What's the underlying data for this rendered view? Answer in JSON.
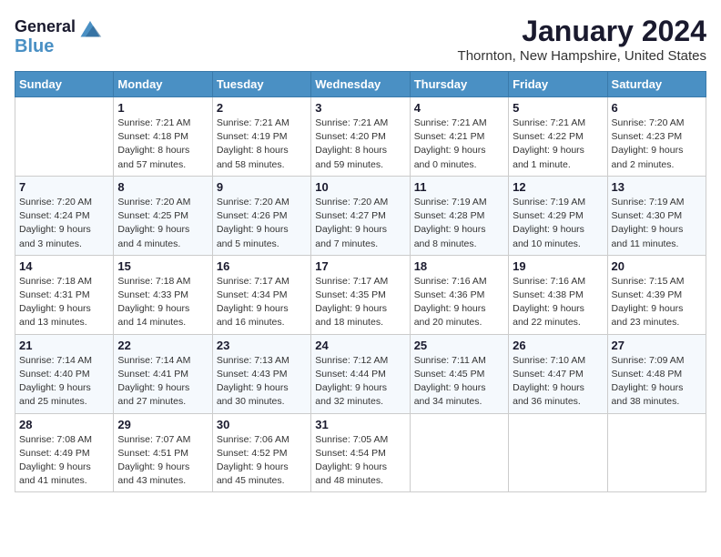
{
  "header": {
    "logo_line1": "General",
    "logo_line2": "Blue",
    "month": "January 2024",
    "location": "Thornton, New Hampshire, United States"
  },
  "weekdays": [
    "Sunday",
    "Monday",
    "Tuesday",
    "Wednesday",
    "Thursday",
    "Friday",
    "Saturday"
  ],
  "weeks": [
    [
      {
        "day": "",
        "info": ""
      },
      {
        "day": "1",
        "info": "Sunrise: 7:21 AM\nSunset: 4:18 PM\nDaylight: 8 hours\nand 57 minutes."
      },
      {
        "day": "2",
        "info": "Sunrise: 7:21 AM\nSunset: 4:19 PM\nDaylight: 8 hours\nand 58 minutes."
      },
      {
        "day": "3",
        "info": "Sunrise: 7:21 AM\nSunset: 4:20 PM\nDaylight: 8 hours\nand 59 minutes."
      },
      {
        "day": "4",
        "info": "Sunrise: 7:21 AM\nSunset: 4:21 PM\nDaylight: 9 hours\nand 0 minutes."
      },
      {
        "day": "5",
        "info": "Sunrise: 7:21 AM\nSunset: 4:22 PM\nDaylight: 9 hours\nand 1 minute."
      },
      {
        "day": "6",
        "info": "Sunrise: 7:20 AM\nSunset: 4:23 PM\nDaylight: 9 hours\nand 2 minutes."
      }
    ],
    [
      {
        "day": "7",
        "info": "Sunrise: 7:20 AM\nSunset: 4:24 PM\nDaylight: 9 hours\nand 3 minutes."
      },
      {
        "day": "8",
        "info": "Sunrise: 7:20 AM\nSunset: 4:25 PM\nDaylight: 9 hours\nand 4 minutes."
      },
      {
        "day": "9",
        "info": "Sunrise: 7:20 AM\nSunset: 4:26 PM\nDaylight: 9 hours\nand 5 minutes."
      },
      {
        "day": "10",
        "info": "Sunrise: 7:20 AM\nSunset: 4:27 PM\nDaylight: 9 hours\nand 7 minutes."
      },
      {
        "day": "11",
        "info": "Sunrise: 7:19 AM\nSunset: 4:28 PM\nDaylight: 9 hours\nand 8 minutes."
      },
      {
        "day": "12",
        "info": "Sunrise: 7:19 AM\nSunset: 4:29 PM\nDaylight: 9 hours\nand 10 minutes."
      },
      {
        "day": "13",
        "info": "Sunrise: 7:19 AM\nSunset: 4:30 PM\nDaylight: 9 hours\nand 11 minutes."
      }
    ],
    [
      {
        "day": "14",
        "info": "Sunrise: 7:18 AM\nSunset: 4:31 PM\nDaylight: 9 hours\nand 13 minutes."
      },
      {
        "day": "15",
        "info": "Sunrise: 7:18 AM\nSunset: 4:33 PM\nDaylight: 9 hours\nand 14 minutes."
      },
      {
        "day": "16",
        "info": "Sunrise: 7:17 AM\nSunset: 4:34 PM\nDaylight: 9 hours\nand 16 minutes."
      },
      {
        "day": "17",
        "info": "Sunrise: 7:17 AM\nSunset: 4:35 PM\nDaylight: 9 hours\nand 18 minutes."
      },
      {
        "day": "18",
        "info": "Sunrise: 7:16 AM\nSunset: 4:36 PM\nDaylight: 9 hours\nand 20 minutes."
      },
      {
        "day": "19",
        "info": "Sunrise: 7:16 AM\nSunset: 4:38 PM\nDaylight: 9 hours\nand 22 minutes."
      },
      {
        "day": "20",
        "info": "Sunrise: 7:15 AM\nSunset: 4:39 PM\nDaylight: 9 hours\nand 23 minutes."
      }
    ],
    [
      {
        "day": "21",
        "info": "Sunrise: 7:14 AM\nSunset: 4:40 PM\nDaylight: 9 hours\nand 25 minutes."
      },
      {
        "day": "22",
        "info": "Sunrise: 7:14 AM\nSunset: 4:41 PM\nDaylight: 9 hours\nand 27 minutes."
      },
      {
        "day": "23",
        "info": "Sunrise: 7:13 AM\nSunset: 4:43 PM\nDaylight: 9 hours\nand 30 minutes."
      },
      {
        "day": "24",
        "info": "Sunrise: 7:12 AM\nSunset: 4:44 PM\nDaylight: 9 hours\nand 32 minutes."
      },
      {
        "day": "25",
        "info": "Sunrise: 7:11 AM\nSunset: 4:45 PM\nDaylight: 9 hours\nand 34 minutes."
      },
      {
        "day": "26",
        "info": "Sunrise: 7:10 AM\nSunset: 4:47 PM\nDaylight: 9 hours\nand 36 minutes."
      },
      {
        "day": "27",
        "info": "Sunrise: 7:09 AM\nSunset: 4:48 PM\nDaylight: 9 hours\nand 38 minutes."
      }
    ],
    [
      {
        "day": "28",
        "info": "Sunrise: 7:08 AM\nSunset: 4:49 PM\nDaylight: 9 hours\nand 41 minutes."
      },
      {
        "day": "29",
        "info": "Sunrise: 7:07 AM\nSunset: 4:51 PM\nDaylight: 9 hours\nand 43 minutes."
      },
      {
        "day": "30",
        "info": "Sunrise: 7:06 AM\nSunset: 4:52 PM\nDaylight: 9 hours\nand 45 minutes."
      },
      {
        "day": "31",
        "info": "Sunrise: 7:05 AM\nSunset: 4:54 PM\nDaylight: 9 hours\nand 48 minutes."
      },
      {
        "day": "",
        "info": ""
      },
      {
        "day": "",
        "info": ""
      },
      {
        "day": "",
        "info": ""
      }
    ]
  ]
}
